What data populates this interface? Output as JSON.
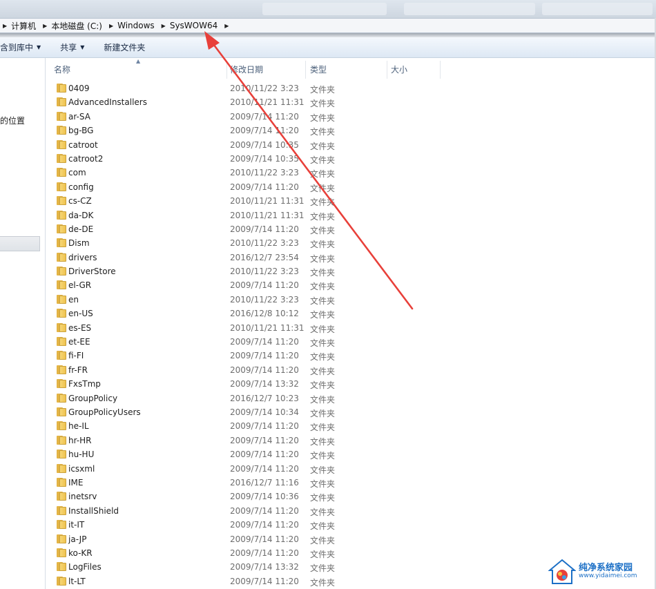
{
  "breadcrumb": [
    {
      "label": "计算机"
    },
    {
      "label": "本地磁盘 (C:)"
    },
    {
      "label": "Windows"
    },
    {
      "label": "SysWOW64"
    }
  ],
  "toolbar": {
    "include_library": "含到库中",
    "share": "共享",
    "new_folder": "新建文件夹"
  },
  "navpane": {
    "location_label": "的位置"
  },
  "columns": {
    "name": "名称",
    "date": "修改日期",
    "type": "类型",
    "size": "大小"
  },
  "files": [
    {
      "name": "0409",
      "date": "2010/11/22 3:23",
      "type": "文件夹"
    },
    {
      "name": "AdvancedInstallers",
      "date": "2010/11/21 11:31",
      "type": "文件夹"
    },
    {
      "name": "ar-SA",
      "date": "2009/7/14 11:20",
      "type": "文件夹"
    },
    {
      "name": "bg-BG",
      "date": "2009/7/14 11:20",
      "type": "文件夹"
    },
    {
      "name": "catroot",
      "date": "2009/7/14 10:35",
      "type": "文件夹"
    },
    {
      "name": "catroot2",
      "date": "2009/7/14 10:35",
      "type": "文件夹"
    },
    {
      "name": "com",
      "date": "2010/11/22 3:23",
      "type": "文件夹"
    },
    {
      "name": "config",
      "date": "2009/7/14 11:20",
      "type": "文件夹"
    },
    {
      "name": "cs-CZ",
      "date": "2010/11/21 11:31",
      "type": "文件夹"
    },
    {
      "name": "da-DK",
      "date": "2010/11/21 11:31",
      "type": "文件夹"
    },
    {
      "name": "de-DE",
      "date": "2009/7/14 11:20",
      "type": "文件夹"
    },
    {
      "name": "Dism",
      "date": "2010/11/22 3:23",
      "type": "文件夹"
    },
    {
      "name": "drivers",
      "date": "2016/12/7 23:54",
      "type": "文件夹"
    },
    {
      "name": "DriverStore",
      "date": "2010/11/22 3:23",
      "type": "文件夹"
    },
    {
      "name": "el-GR",
      "date": "2009/7/14 11:20",
      "type": "文件夹"
    },
    {
      "name": "en",
      "date": "2010/11/22 3:23",
      "type": "文件夹"
    },
    {
      "name": "en-US",
      "date": "2016/12/8 10:12",
      "type": "文件夹"
    },
    {
      "name": "es-ES",
      "date": "2010/11/21 11:31",
      "type": "文件夹"
    },
    {
      "name": "et-EE",
      "date": "2009/7/14 11:20",
      "type": "文件夹"
    },
    {
      "name": "fi-FI",
      "date": "2009/7/14 11:20",
      "type": "文件夹"
    },
    {
      "name": "fr-FR",
      "date": "2009/7/14 11:20",
      "type": "文件夹"
    },
    {
      "name": "FxsTmp",
      "date": "2009/7/14 13:32",
      "type": "文件夹"
    },
    {
      "name": "GroupPolicy",
      "date": "2016/12/7 10:23",
      "type": "文件夹"
    },
    {
      "name": "GroupPolicyUsers",
      "date": "2009/7/14 10:34",
      "type": "文件夹"
    },
    {
      "name": "he-IL",
      "date": "2009/7/14 11:20",
      "type": "文件夹"
    },
    {
      "name": "hr-HR",
      "date": "2009/7/14 11:20",
      "type": "文件夹"
    },
    {
      "name": "hu-HU",
      "date": "2009/7/14 11:20",
      "type": "文件夹"
    },
    {
      "name": "icsxml",
      "date": "2009/7/14 11:20",
      "type": "文件夹"
    },
    {
      "name": "IME",
      "date": "2016/12/7 11:16",
      "type": "文件夹"
    },
    {
      "name": "inetsrv",
      "date": "2009/7/14 10:36",
      "type": "文件夹"
    },
    {
      "name": "InstallShield",
      "date": "2009/7/14 11:20",
      "type": "文件夹"
    },
    {
      "name": "it-IT",
      "date": "2009/7/14 11:20",
      "type": "文件夹"
    },
    {
      "name": "ja-JP",
      "date": "2009/7/14 11:20",
      "type": "文件夹"
    },
    {
      "name": "ko-KR",
      "date": "2009/7/14 11:20",
      "type": "文件夹"
    },
    {
      "name": "LogFiles",
      "date": "2009/7/14 13:32",
      "type": "文件夹"
    },
    {
      "name": "lt-LT",
      "date": "2009/7/14 11:20",
      "type": "文件夹"
    }
  ],
  "watermark": {
    "title": "纯净系统家园",
    "url": "www.yidaimei.com"
  },
  "colors": {
    "annotation_arrow": "#e8403a",
    "folder": "#f0c453",
    "watermark_blue": "#1b6fc6"
  }
}
